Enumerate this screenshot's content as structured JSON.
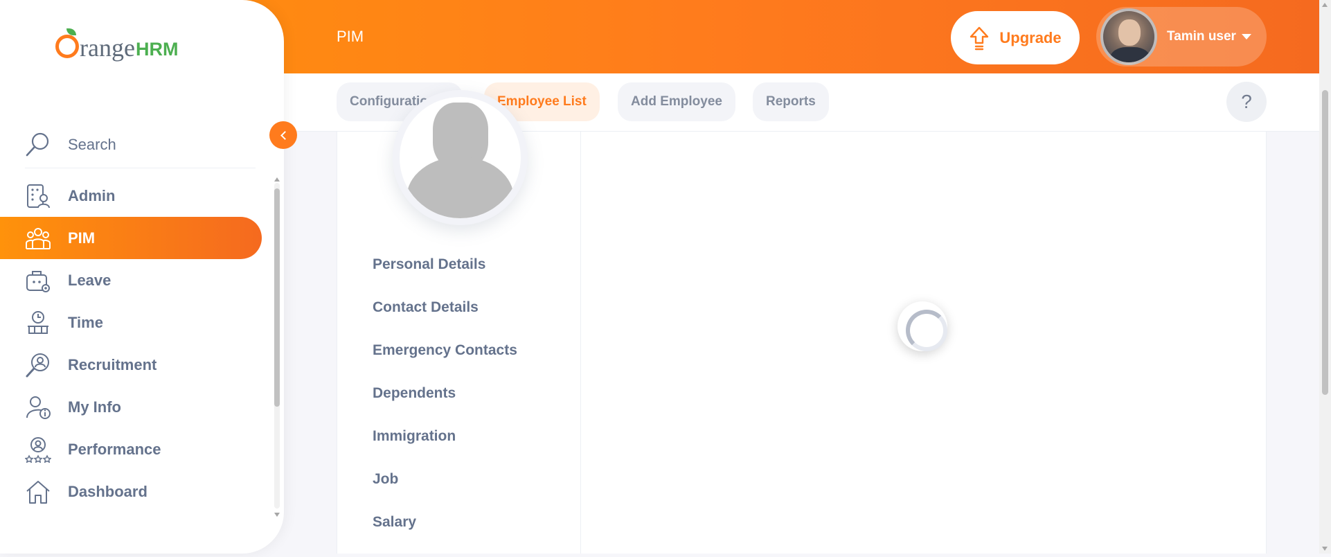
{
  "header": {
    "module_title": "PIM",
    "upgrade_label": "Upgrade",
    "user_name": "Tamin user",
    "help_label": "?"
  },
  "subnav": {
    "configuration": "Configuration",
    "employee_list": "Employee List",
    "add_employee": "Add Employee",
    "reports": "Reports",
    "active": "Employee List"
  },
  "sidebar": {
    "logo_o": "O",
    "logo_range": "range",
    "logo_hrm": "HRM",
    "search_label": "Search",
    "items": [
      {
        "label": "Admin",
        "icon": "admin-icon"
      },
      {
        "label": "PIM",
        "icon": "pim-icon",
        "active": true
      },
      {
        "label": "Leave",
        "icon": "leave-icon"
      },
      {
        "label": "Time",
        "icon": "time-icon"
      },
      {
        "label": "Recruitment",
        "icon": "recruitment-icon"
      },
      {
        "label": "My Info",
        "icon": "my-info-icon"
      },
      {
        "label": "Performance",
        "icon": "performance-icon"
      },
      {
        "label": "Dashboard",
        "icon": "dashboard-icon"
      }
    ]
  },
  "employee_tabs": [
    "Personal Details",
    "Contact Details",
    "Emergency Contacts",
    "Dependents",
    "Immigration",
    "Job",
    "Salary"
  ],
  "colors": {
    "brand_orange": "#ff7b1d",
    "brand_orange_light": "#ff920b",
    "text_muted": "#64728c"
  }
}
